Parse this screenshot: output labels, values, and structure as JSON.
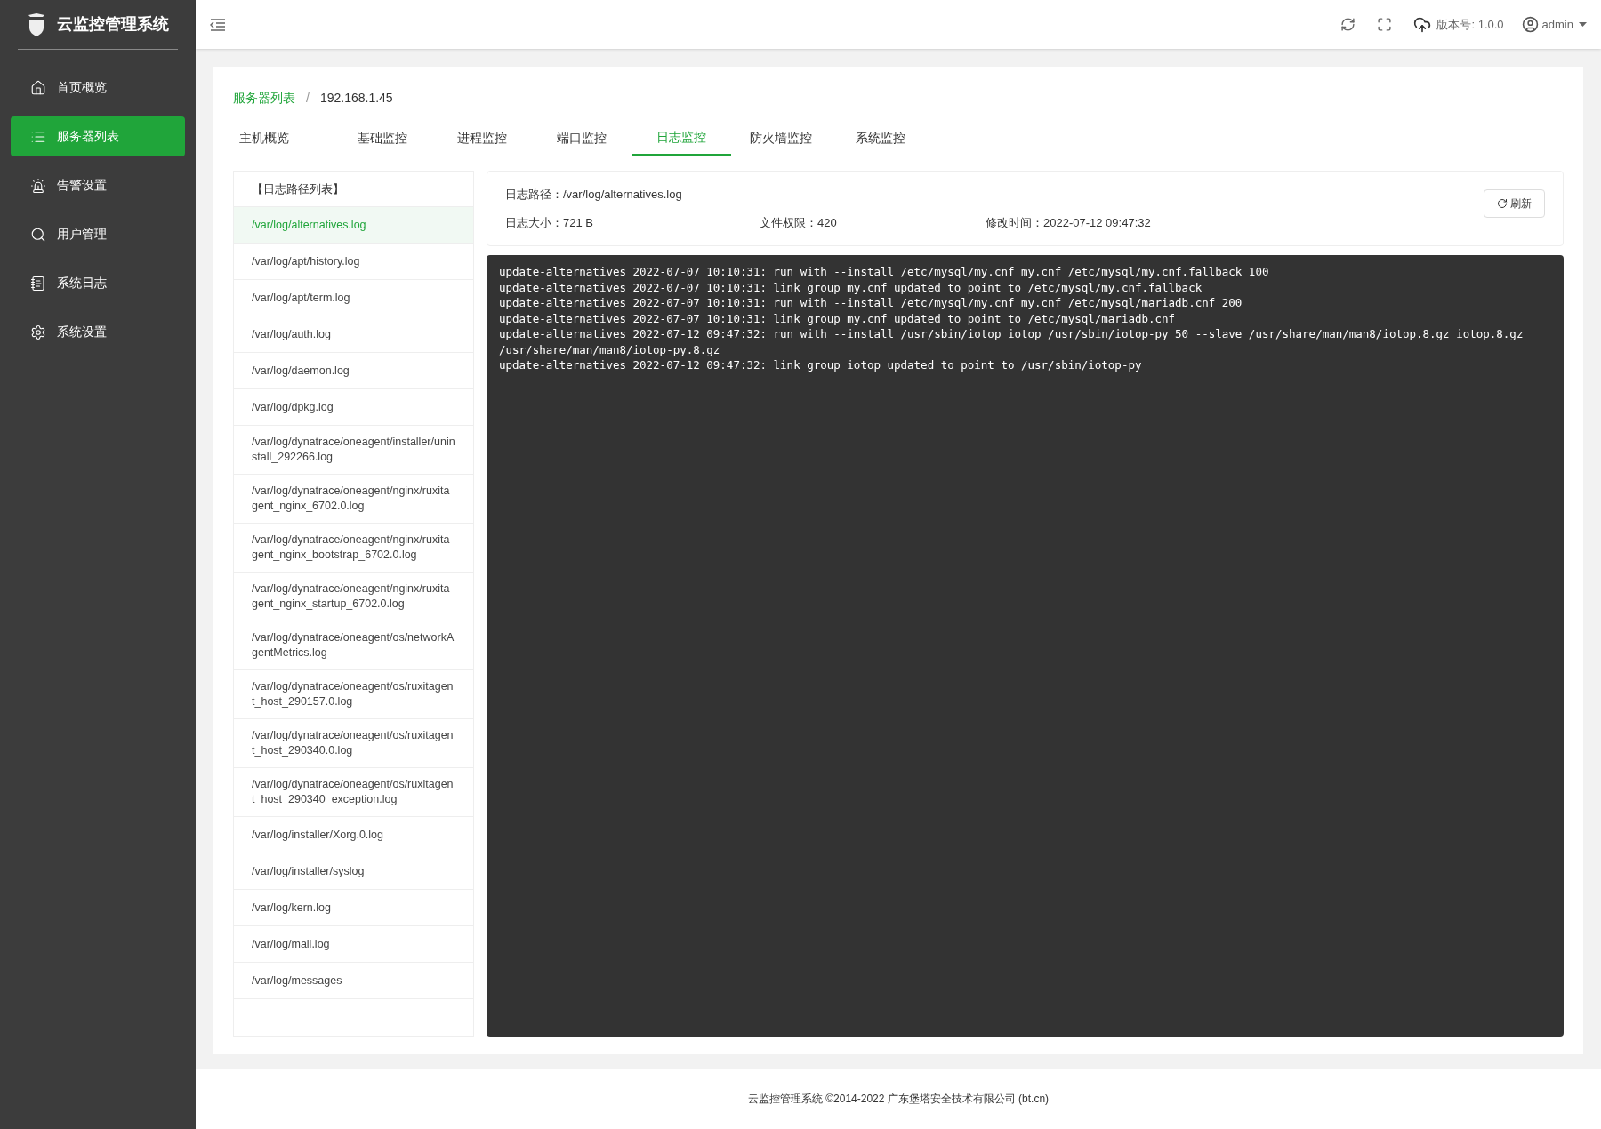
{
  "sidebar": {
    "title": "云监控管理系统",
    "items": [
      {
        "label": "首页概览",
        "kind": "home",
        "selected": false
      },
      {
        "label": "服务器列表",
        "kind": "list",
        "selected": true
      },
      {
        "label": "告警设置",
        "kind": "alarm",
        "selected": false
      },
      {
        "label": "用户管理",
        "kind": "search",
        "selected": false
      },
      {
        "label": "系统日志",
        "kind": "log",
        "selected": false
      },
      {
        "label": "系统设置",
        "kind": "settings",
        "selected": false
      }
    ]
  },
  "header": {
    "version": "版本号: 1.0.0",
    "user": "admin"
  },
  "breadcrumb": {
    "parent": "服务器列表",
    "separator": "/",
    "current": "192.168.1.45"
  },
  "tabs": [
    {
      "label": "主机概览",
      "selected": false
    },
    {
      "label": "基础监控",
      "selected": false
    },
    {
      "label": "进程监控",
      "selected": false
    },
    {
      "label": "端口监控",
      "selected": false
    },
    {
      "label": "日志监控",
      "selected": true
    },
    {
      "label": "防火墙监控",
      "selected": false
    },
    {
      "label": "系统监控",
      "selected": false
    }
  ],
  "log_list": {
    "title": "【日志路径列表】",
    "items": [
      {
        "path": "/var/log/alternatives.log",
        "selected": true
      },
      {
        "path": "/var/log/apt/history.log",
        "selected": false
      },
      {
        "path": "/var/log/apt/term.log",
        "selected": false
      },
      {
        "path": "/var/log/auth.log",
        "selected": false
      },
      {
        "path": "/var/log/daemon.log",
        "selected": false
      },
      {
        "path": "/var/log/dpkg.log",
        "selected": false
      },
      {
        "path": "/var/log/dynatrace/oneagent/installer/uninstall_292266.log",
        "selected": false
      },
      {
        "path": "/var/log/dynatrace/oneagent/nginx/ruxitagent_nginx_6702.0.log",
        "selected": false
      },
      {
        "path": "/var/log/dynatrace/oneagent/nginx/ruxitagent_nginx_bootstrap_6702.0.log",
        "selected": false
      },
      {
        "path": "/var/log/dynatrace/oneagent/nginx/ruxitagent_nginx_startup_6702.0.log",
        "selected": false
      },
      {
        "path": "/var/log/dynatrace/oneagent/os/networkAgentMetrics.log",
        "selected": false
      },
      {
        "path": "/var/log/dynatrace/oneagent/os/ruxitagent_host_290157.0.log",
        "selected": false
      },
      {
        "path": "/var/log/dynatrace/oneagent/os/ruxitagent_host_290340.0.log",
        "selected": false
      },
      {
        "path": "/var/log/dynatrace/oneagent/os/ruxitagent_host_290340_exception.log",
        "selected": false
      },
      {
        "path": "/var/log/installer/Xorg.0.log",
        "selected": false
      },
      {
        "path": "/var/log/installer/syslog",
        "selected": false
      },
      {
        "path": "/var/log/kern.log",
        "selected": false
      },
      {
        "path": "/var/log/mail.log",
        "selected": false
      },
      {
        "path": "/var/log/messages",
        "selected": false
      }
    ]
  },
  "log_info": {
    "path": "日志路径：/var/log/alternatives.log",
    "size": "日志大小：721 B",
    "permission": "文件权限：420",
    "modified": "修改时间：2022-07-12 09:47:32",
    "refresh": "刷新"
  },
  "log_lines": [
    "update-alternatives 2022-07-07 10:10:31: run with --install /etc/mysql/my.cnf my.cnf /etc/mysql/my.cnf.fallback 100",
    "update-alternatives 2022-07-07 10:10:31: link group my.cnf updated to point to /etc/mysql/my.cnf.fallback",
    "update-alternatives 2022-07-07 10:10:31: run with --install /etc/mysql/my.cnf my.cnf /etc/mysql/mariadb.cnf 200",
    "update-alternatives 2022-07-07 10:10:31: link group my.cnf updated to point to /etc/mysql/mariadb.cnf",
    "update-alternatives 2022-07-12 09:47:32: run with --install /usr/sbin/iotop iotop /usr/sbin/iotop-py 50 --slave /usr/share/man/man8/iotop.8.gz iotop.8.gz /usr/share/man/man8/iotop-py.8.gz",
    "update-alternatives 2022-07-12 09:47:32: link group iotop updated to point to /usr/sbin/iotop-py"
  ],
  "footer": "云监控管理系统 ©2014-2022 广东堡塔安全技术有限公司 (bt.cn)"
}
